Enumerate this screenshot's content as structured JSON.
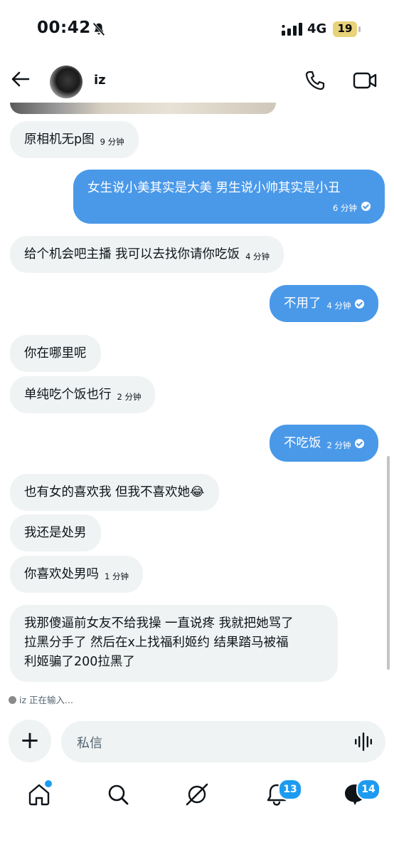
{
  "status": {
    "time": "00:42",
    "network": "4G",
    "battery": "19"
  },
  "header": {
    "contact_name": "iz"
  },
  "messages": [
    {
      "text": "原相机无p图",
      "time": "9 分钟"
    },
    {
      "text": "女生说小美其实是大美 男生说小帅其实是小丑",
      "time": "6 分钟"
    },
    {
      "text": "给个机会吧主播 我可以去找你请你吃饭",
      "time": "4 分钟"
    },
    {
      "text": "不用了",
      "time": "4 分钟"
    },
    {
      "text": "你在哪里呢"
    },
    {
      "text": "单纯吃个饭也行",
      "time": "2 分钟"
    },
    {
      "text": "不吃饭",
      "time": "2 分钟"
    },
    {
      "text": "也有女的喜欢我 但我不喜欢她😂"
    },
    {
      "text": "我还是处男"
    },
    {
      "text": "你喜欢处男吗",
      "time": "1 分钟"
    },
    {
      "line1": "我那傻逼前女友不给我操 一直说疼 我就把她骂了",
      "line2": "拉黑分手了 然后在x上找福利姬约 结果踏马被福",
      "line3": "利姬骗了200拉黑了"
    }
  ],
  "typing_indicator": "iz 正在输入...",
  "composer": {
    "placeholder": "私信"
  },
  "nav": {
    "notifications_badge": "13",
    "messages_badge": "14"
  },
  "colors": {
    "outgoing_bubble": "#4a99e9",
    "incoming_bubble": "#eff3f4",
    "badge": "#1d9bf0"
  }
}
